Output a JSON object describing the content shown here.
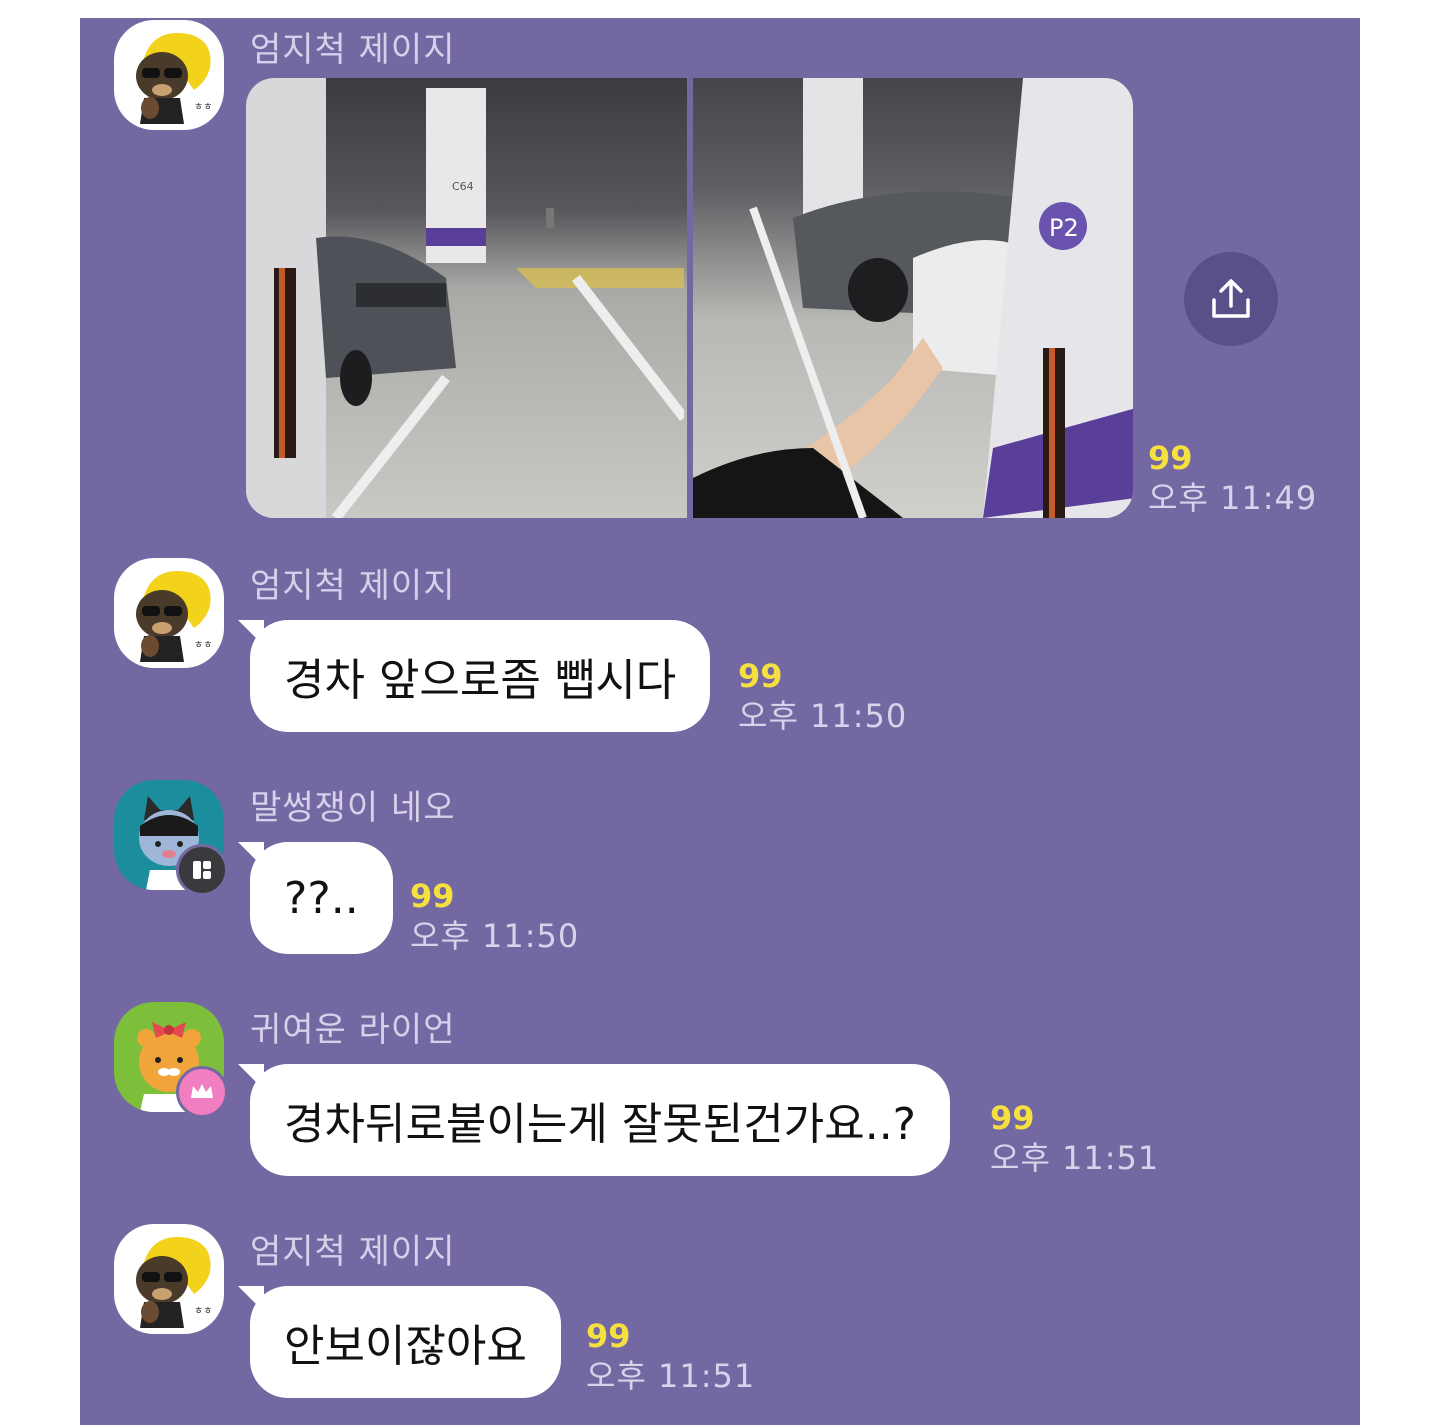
{
  "messages": [
    {
      "sender": "엄지척 제이지",
      "type": "photos",
      "photo_labels": [
        "C64",
        "P2"
      ],
      "read_count": "99",
      "time": "오후 11:49"
    },
    {
      "sender": "엄지척 제이지",
      "text": "경차 앞으로좀 뺍시다",
      "read_count": "99",
      "time": "오후 11:50"
    },
    {
      "sender": "말썽쟁이 네오",
      "text": "??..",
      "read_count": "99",
      "time": "오후 11:50"
    },
    {
      "sender": "귀여운 라이언",
      "text": "경차뒤로붙이는게 잘못된건가요..?",
      "read_count": "99",
      "time": "오후 11:51"
    },
    {
      "sender": "엄지척 제이지",
      "text": "안보이잖아요",
      "read_count": "99",
      "time": "오후 11:51"
    }
  ],
  "colors": {
    "background": "#7468a2",
    "bubble": "#ffffff",
    "read_count": "#f6e040",
    "meta_text": "#d8d2ea"
  },
  "icons": {
    "share": "share-upload-icon",
    "neo_badge": "open-profile-badge-icon",
    "ryan_badge": "crown-badge-icon"
  }
}
